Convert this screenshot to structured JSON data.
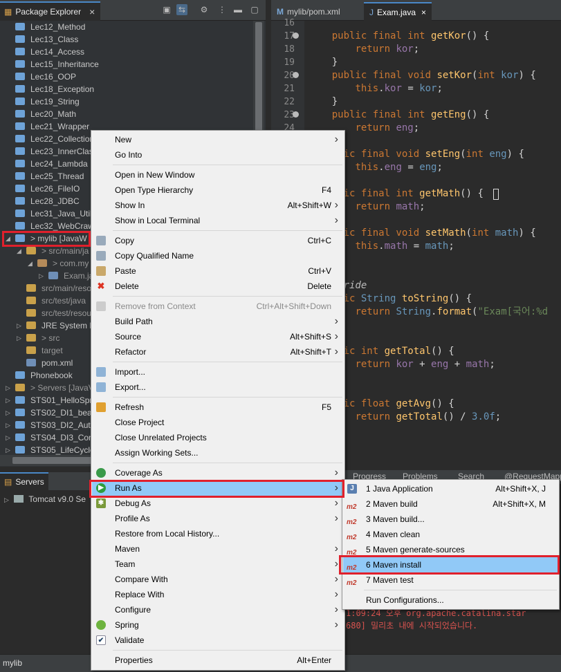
{
  "package_explorer": {
    "tab_label": "Package Explorer",
    "tree": [
      {
        "label": "Lec12_Method",
        "indent": 0,
        "type": "folder"
      },
      {
        "label": "Lec13_Class",
        "indent": 0,
        "type": "folder"
      },
      {
        "label": "Lec14_Access",
        "indent": 0,
        "type": "folder"
      },
      {
        "label": "Lec15_Inheritance",
        "indent": 0,
        "type": "folder"
      },
      {
        "label": "Lec16_OOP",
        "indent": 0,
        "type": "folder"
      },
      {
        "label": "Lec18_Exception",
        "indent": 0,
        "type": "folder"
      },
      {
        "label": "Lec19_String",
        "indent": 0,
        "type": "folder"
      },
      {
        "label": "Lec20_Math",
        "indent": 0,
        "type": "folder"
      },
      {
        "label": "Lec21_Wrapper",
        "indent": 0,
        "type": "folder"
      },
      {
        "label": "Lec22_Collection",
        "indent": 0,
        "type": "folder"
      },
      {
        "label": "Lec23_InnerClas",
        "indent": 0,
        "type": "folder"
      },
      {
        "label": "Lec24_Lambda",
        "indent": 0,
        "type": "folder"
      },
      {
        "label": "Lec25_Thread",
        "indent": 0,
        "type": "folder"
      },
      {
        "label": "Lec26_FileIO",
        "indent": 0,
        "type": "folder"
      },
      {
        "label": "Lec28_JDBC",
        "indent": 0,
        "type": "folder"
      },
      {
        "label": "Lec31_Java_Util",
        "indent": 0,
        "type": "folder"
      },
      {
        "label": "Lec32_WebCraw",
        "indent": 0,
        "type": "folder"
      },
      {
        "label": "> mylib [JavaW",
        "indent": 0,
        "type": "project",
        "twisty": "open"
      },
      {
        "label": "> src/main/ja",
        "indent": 1,
        "type": "src",
        "twisty": "open",
        "gray": true
      },
      {
        "label": "> com.my",
        "indent": 2,
        "type": "pkg",
        "twisty": "open",
        "gray": true
      },
      {
        "label": "Exam.ja",
        "indent": 3,
        "type": "file",
        "twisty": "closed",
        "gray": true
      },
      {
        "label": "src/main/reso",
        "indent": 1,
        "type": "src",
        "gray": true
      },
      {
        "label": "src/test/java",
        "indent": 1,
        "type": "src",
        "gray": true
      },
      {
        "label": "src/test/resou",
        "indent": 1,
        "type": "src",
        "gray": true
      },
      {
        "label": "JRE System L",
        "indent": 1,
        "type": "lib",
        "twisty": "closed"
      },
      {
        "label": "> src",
        "indent": 1,
        "type": "src",
        "twisty": "closed",
        "gray": true
      },
      {
        "label": "target",
        "indent": 1,
        "type": "folder2",
        "gray": true
      },
      {
        "label": "pom.xml",
        "indent": 1,
        "type": "file"
      },
      {
        "label": "Phonebook",
        "indent": 0,
        "type": "folder"
      },
      {
        "label": "> Servers [JavaV",
        "indent": 0,
        "type": "folder2",
        "twisty": "closed",
        "gray": true
      },
      {
        "label": "STS01_HelloSpri",
        "indent": 0,
        "type": "folder",
        "twisty": "closed"
      },
      {
        "label": "STS02_DI1_bean",
        "indent": 0,
        "type": "folder",
        "twisty": "closed"
      },
      {
        "label": "STS03_DI2_Auto",
        "indent": 0,
        "type": "folder",
        "twisty": "closed"
      },
      {
        "label": "STS04_DI3_Con",
        "indent": 0,
        "type": "folder",
        "twisty": "closed"
      },
      {
        "label": "STS05_LifeCycle",
        "indent": 0,
        "type": "folder",
        "twisty": "closed"
      }
    ]
  },
  "editor": {
    "tabs": [
      {
        "label": "mylib/pom.xml",
        "active": false
      },
      {
        "label": "Exam.java",
        "active": true
      }
    ],
    "lines": [
      {
        "n": "16",
        "code": []
      },
      {
        "n": "17",
        "fold": true,
        "code": [
          [
            "",
            "    "
          ],
          [
            "kw",
            "public final int "
          ],
          [
            "fn",
            "getKor"
          ],
          [
            "",
            "() {"
          ]
        ]
      },
      {
        "n": "18",
        "code": [
          [
            "",
            "        "
          ],
          [
            "kw",
            "return "
          ],
          [
            "fd",
            "kor"
          ],
          [
            "",
            ";"
          ]
        ]
      },
      {
        "n": "19",
        "code": [
          [
            "",
            "    }"
          ]
        ]
      },
      {
        "n": "20",
        "fold": true,
        "code": [
          [
            "",
            "    "
          ],
          [
            "kw",
            "public final void "
          ],
          [
            "fn",
            "setKor"
          ],
          [
            "",
            "("
          ],
          [
            "kw",
            "int "
          ],
          [
            "ty",
            "kor"
          ],
          [
            "",
            ") {"
          ]
        ]
      },
      {
        "n": "21",
        "code": [
          [
            "",
            "        "
          ],
          [
            "kw",
            "this"
          ],
          [
            "",
            "."
          ],
          [
            "fd",
            "kor"
          ],
          [
            "",
            " = "
          ],
          [
            "ty",
            "kor"
          ],
          [
            "",
            ";"
          ]
        ]
      },
      {
        "n": "22",
        "code": [
          [
            "",
            "    }"
          ]
        ]
      },
      {
        "n": "23",
        "fold": true,
        "code": [
          [
            "",
            "    "
          ],
          [
            "kw",
            "public final int "
          ],
          [
            "fn",
            "getEng"
          ],
          [
            "",
            "() {"
          ]
        ]
      },
      {
        "n": "24",
        "code": [
          [
            "",
            "        "
          ],
          [
            "kw",
            "return "
          ],
          [
            "fd",
            "eng"
          ],
          [
            "",
            ";"
          ]
        ]
      },
      {
        "n": "",
        "code": []
      },
      {
        "n": "",
        "code": [
          [
            "",
            "    "
          ],
          [
            "kw",
            "blic final void "
          ],
          [
            "fn",
            "setEng"
          ],
          [
            "",
            "("
          ],
          [
            "kw",
            "int "
          ],
          [
            "ty",
            "eng"
          ],
          [
            "",
            ") {"
          ]
        ]
      },
      {
        "n": "",
        "code": [
          [
            "",
            "        "
          ],
          [
            "kw",
            "this"
          ],
          [
            "",
            "."
          ],
          [
            "fd",
            "eng"
          ],
          [
            "",
            " = "
          ],
          [
            "ty",
            "eng"
          ],
          [
            "",
            ";"
          ]
        ]
      },
      {
        "n": "",
        "code": []
      },
      {
        "n": "",
        "code": [
          [
            "",
            "    "
          ],
          [
            "kw",
            "blic final int "
          ],
          [
            "fn",
            "getMath"
          ],
          [
            "",
            "() {"
          ]
        ]
      },
      {
        "n": "",
        "code": [
          [
            "",
            "        "
          ],
          [
            "kw",
            "return "
          ],
          [
            "fd",
            "math"
          ],
          [
            "",
            ";"
          ]
        ]
      },
      {
        "n": "",
        "code": []
      },
      {
        "n": "",
        "code": [
          [
            "",
            "    "
          ],
          [
            "kw",
            "blic final void "
          ],
          [
            "fn",
            "setMath"
          ],
          [
            "",
            "("
          ],
          [
            "kw",
            "int "
          ],
          [
            "ty",
            "math"
          ],
          [
            "",
            ") {"
          ]
        ]
      },
      {
        "n": "",
        "code": [
          [
            "",
            "        "
          ],
          [
            "kw",
            "this"
          ],
          [
            "",
            "."
          ],
          [
            "fd",
            "math"
          ],
          [
            "",
            " = "
          ],
          [
            "ty",
            "math"
          ],
          [
            "",
            ";"
          ]
        ]
      },
      {
        "n": "",
        "code": []
      },
      {
        "n": "",
        "code": []
      },
      {
        "n": "",
        "code": [
          [
            "",
            "    "
          ],
          [
            "an",
            "erride"
          ]
        ]
      },
      {
        "n": "",
        "code": [
          [
            "",
            "    "
          ],
          [
            "kw",
            "blic "
          ],
          [
            "ty",
            "String "
          ],
          [
            "fn",
            "toString"
          ],
          [
            "",
            "() {"
          ]
        ]
      },
      {
        "n": "",
        "code": [
          [
            "",
            "        "
          ],
          [
            "kw",
            "return "
          ],
          [
            "ty",
            "String"
          ],
          [
            "",
            "."
          ],
          [
            "fn",
            "format"
          ],
          [
            "",
            "("
          ],
          [
            "st",
            "\"Exam[국어:%d"
          ]
        ]
      },
      {
        "n": "",
        "code": []
      },
      {
        "n": "",
        "code": []
      },
      {
        "n": "",
        "code": [
          [
            "",
            "    "
          ],
          [
            "kw",
            "blic int "
          ],
          [
            "fn",
            "getTotal"
          ],
          [
            "",
            "() {"
          ]
        ]
      },
      {
        "n": "",
        "code": [
          [
            "",
            "        "
          ],
          [
            "kw",
            "return "
          ],
          [
            "fd",
            "kor"
          ],
          [
            "",
            " + "
          ],
          [
            "fd",
            "eng"
          ],
          [
            "",
            " + "
          ],
          [
            "fd",
            "math"
          ],
          [
            "",
            ";"
          ]
        ]
      },
      {
        "n": "",
        "code": []
      },
      {
        "n": "",
        "code": []
      },
      {
        "n": "",
        "code": [
          [
            "",
            "    "
          ],
          [
            "kw",
            "blic float "
          ],
          [
            "fn",
            "getAvg"
          ],
          [
            "",
            "() {"
          ]
        ]
      },
      {
        "n": "",
        "code": [
          [
            "",
            "        "
          ],
          [
            "kw",
            "return "
          ],
          [
            "fn",
            "getTotal"
          ],
          [
            "",
            "() / "
          ],
          [
            "ty",
            "3.0f"
          ],
          [
            "",
            ";"
          ]
        ]
      }
    ]
  },
  "servers": {
    "tab_label": "Servers",
    "item": "Tomcat v9.0 Se"
  },
  "console": {
    "tabs": [
      "Progress",
      "Problems",
      "Search",
      "@RequestMapp"
    ],
    "lines": [
      "1:09:24 오후 org.apache.catalina.star",
      "680] 밀리초 내에 시작되었습니다."
    ]
  },
  "status_bar": {
    "text": "mylib"
  },
  "context_menu": {
    "items": [
      {
        "label": "New",
        "arrow": true
      },
      {
        "label": "Go Into"
      },
      {
        "sep": true
      },
      {
        "label": "Open in New Window"
      },
      {
        "label": "Open Type Hierarchy",
        "shortcut": "F4"
      },
      {
        "label": "Show In",
        "shortcut": "Alt+Shift+W",
        "arrow": true
      },
      {
        "label": "Show in Local Terminal",
        "arrow": true
      },
      {
        "sep": true
      },
      {
        "label": "Copy",
        "shortcut": "Ctrl+C",
        "icon": "copy-icon"
      },
      {
        "label": "Copy Qualified Name",
        "icon": "copy-icon"
      },
      {
        "label": "Paste",
        "shortcut": "Ctrl+V",
        "icon": "paste-icon"
      },
      {
        "label": "Delete",
        "shortcut": "Delete",
        "icon": "delete-icon"
      },
      {
        "sep": true
      },
      {
        "label": "Remove from Context",
        "shortcut": "Ctrl+Alt+Shift+Down",
        "disabled": true,
        "icon": "remove-context-icon"
      },
      {
        "label": "Build Path",
        "arrow": true
      },
      {
        "label": "Source",
        "shortcut": "Alt+Shift+S",
        "arrow": true
      },
      {
        "label": "Refactor",
        "shortcut": "Alt+Shift+T",
        "arrow": true
      },
      {
        "sep": true
      },
      {
        "label": "Import...",
        "icon": "import-icon"
      },
      {
        "label": "Export...",
        "icon": "export-icon"
      },
      {
        "sep": true
      },
      {
        "label": "Refresh",
        "shortcut": "F5",
        "icon": "refresh-icon"
      },
      {
        "label": "Close Project"
      },
      {
        "label": "Close Unrelated Projects"
      },
      {
        "label": "Assign Working Sets..."
      },
      {
        "sep": true
      },
      {
        "label": "Coverage As",
        "arrow": true,
        "icon": "coverage-icon"
      },
      {
        "label": "Run As",
        "arrow": true,
        "selected": true,
        "icon": "run-icon"
      },
      {
        "label": "Debug As",
        "arrow": true,
        "icon": "debug-icon"
      },
      {
        "label": "Profile As",
        "arrow": true
      },
      {
        "label": "Restore from Local History..."
      },
      {
        "label": "Maven",
        "arrow": true
      },
      {
        "label": "Team",
        "arrow": true
      },
      {
        "label": "Compare With",
        "arrow": true
      },
      {
        "label": "Replace With",
        "arrow": true
      },
      {
        "label": "Configure",
        "arrow": true
      },
      {
        "label": "Spring",
        "arrow": true,
        "icon": "spring-icon"
      },
      {
        "label": "Validate",
        "icon": "validate-check-icon"
      },
      {
        "sep": true
      },
      {
        "label": "Properties",
        "shortcut": "Alt+Enter"
      }
    ]
  },
  "run_as_submenu": {
    "items": [
      {
        "label": "1 Java Application",
        "shortcut": "Alt+Shift+X, J",
        "icon": "java-app-icon"
      },
      {
        "label": "2 Maven build",
        "shortcut": "Alt+Shift+X, M",
        "icon": "m2"
      },
      {
        "label": "3 Maven build...",
        "icon": "m2"
      },
      {
        "label": "4 Maven clean",
        "icon": "m2"
      },
      {
        "label": "5 Maven generate-sources",
        "icon": "m2"
      },
      {
        "label": "6 Maven install",
        "icon": "m2",
        "selected": true
      },
      {
        "label": "7 Maven test",
        "icon": "m2"
      },
      {
        "sep": true
      },
      {
        "label": "Run Configurations..."
      }
    ]
  },
  "m2_label": "m2"
}
